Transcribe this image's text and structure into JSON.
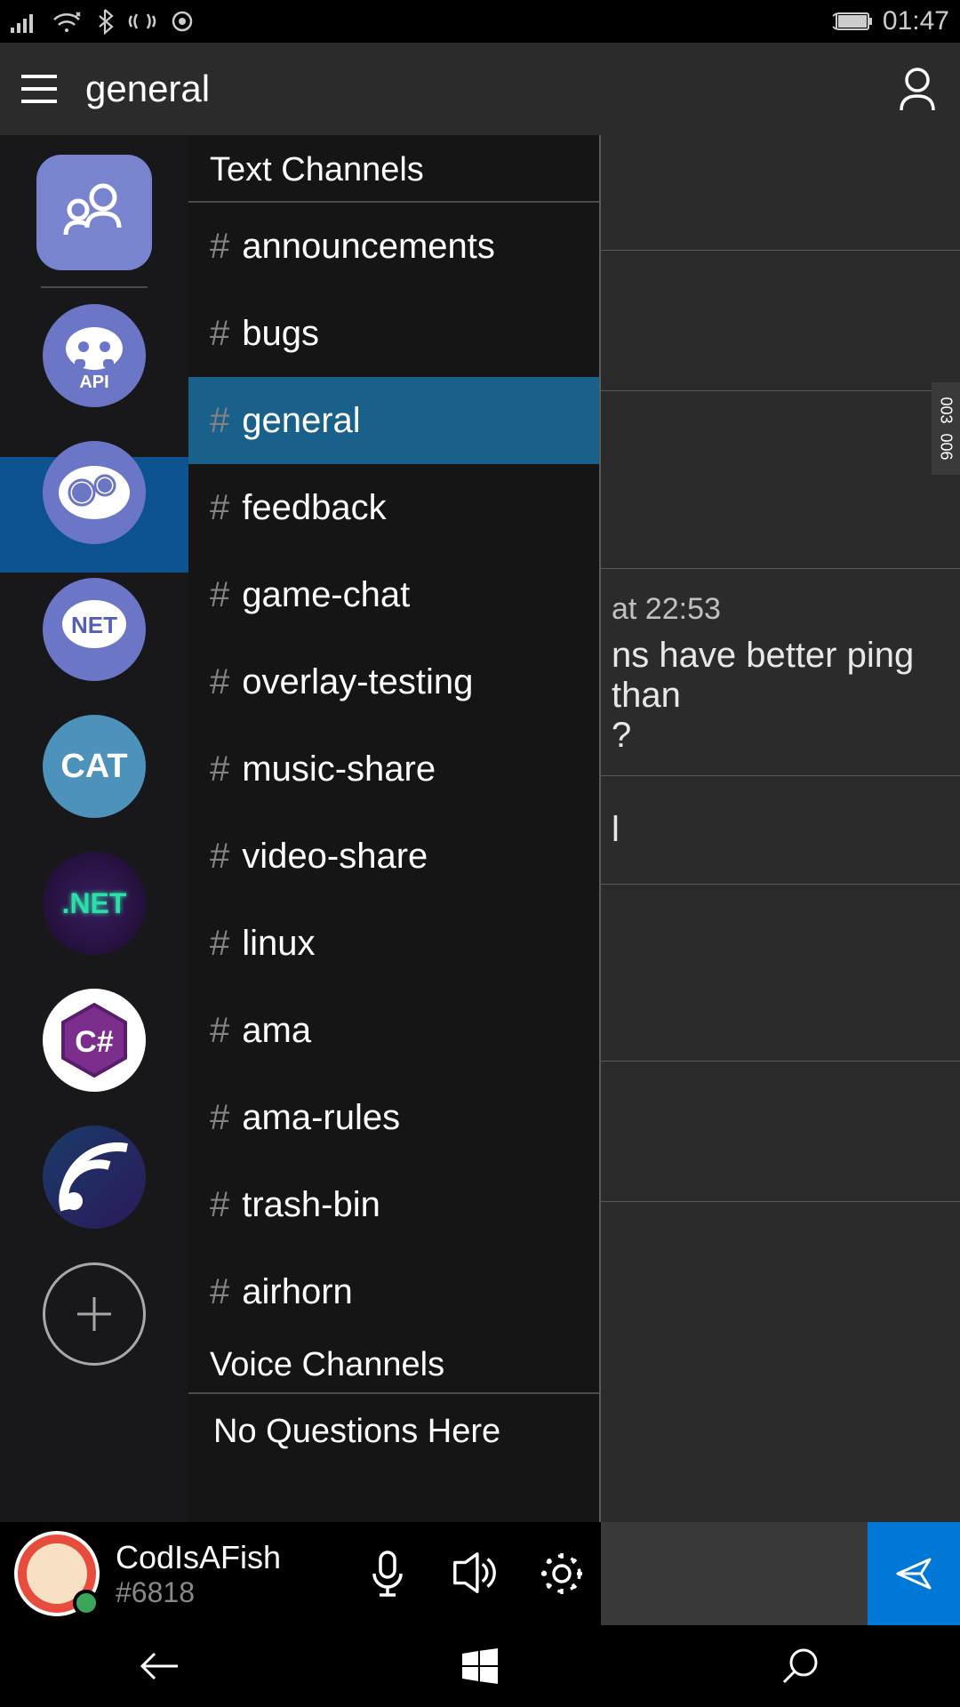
{
  "status_bar": {
    "time": "01:47"
  },
  "header": {
    "title": "general"
  },
  "servers": [
    {
      "id": "home",
      "label": "",
      "type": "home",
      "bg": "#7984cf",
      "selected": false
    },
    {
      "id": "api",
      "label": "API",
      "bg": "#6b76c7",
      "selected": false
    },
    {
      "id": "gears",
      "label": "",
      "type": "gears",
      "bg": "#6b76c7",
      "selected": true
    },
    {
      "id": "net",
      "label": "NET",
      "bg": "#6b76c7",
      "selected": false,
      "badge": true
    },
    {
      "id": "cat",
      "label": "CAT",
      "bg": "#4c92bb",
      "selected": false
    },
    {
      "id": "dotnet",
      "label": ".NET",
      "bg": "#2a1b4a",
      "fg": "#2be0a6",
      "selected": false
    },
    {
      "id": "csharp",
      "label": "C#",
      "bg": "#ffffff",
      "fg": "#7b2e8c",
      "ring": "#7b2e8c",
      "selected": false
    },
    {
      "id": "rss",
      "label": "",
      "type": "rss",
      "bg": "#1e2a45",
      "selected": false
    }
  ],
  "channel_groups": {
    "text_header": "Text Channels",
    "voice_header": "Voice Channels",
    "text": [
      {
        "name": "announcements",
        "selected": false
      },
      {
        "name": "bugs",
        "selected": false
      },
      {
        "name": "general",
        "selected": true
      },
      {
        "name": "feedback",
        "selected": false
      },
      {
        "name": "game-chat",
        "selected": false
      },
      {
        "name": "overlay-testing",
        "selected": false
      },
      {
        "name": "music-share",
        "selected": false
      },
      {
        "name": "video-share",
        "selected": false
      },
      {
        "name": "linux",
        "selected": false
      },
      {
        "name": "ama",
        "selected": false
      },
      {
        "name": "ama-rules",
        "selected": false
      },
      {
        "name": "trash-bin",
        "selected": false
      },
      {
        "name": "airhorn",
        "selected": false
      }
    ],
    "voice": [
      {
        "name": "No Questions Here"
      }
    ]
  },
  "chat": {
    "visible_meta_time": "at 22:53",
    "visible_message_line1": "ns have better ping than",
    "visible_message_line2": "?",
    "visible_fragment_below": "l"
  },
  "side_badge": {
    "top": "003",
    "bottom": "006"
  },
  "user": {
    "name": "CodIsAFish",
    "tag": "#6818",
    "status": "online"
  }
}
